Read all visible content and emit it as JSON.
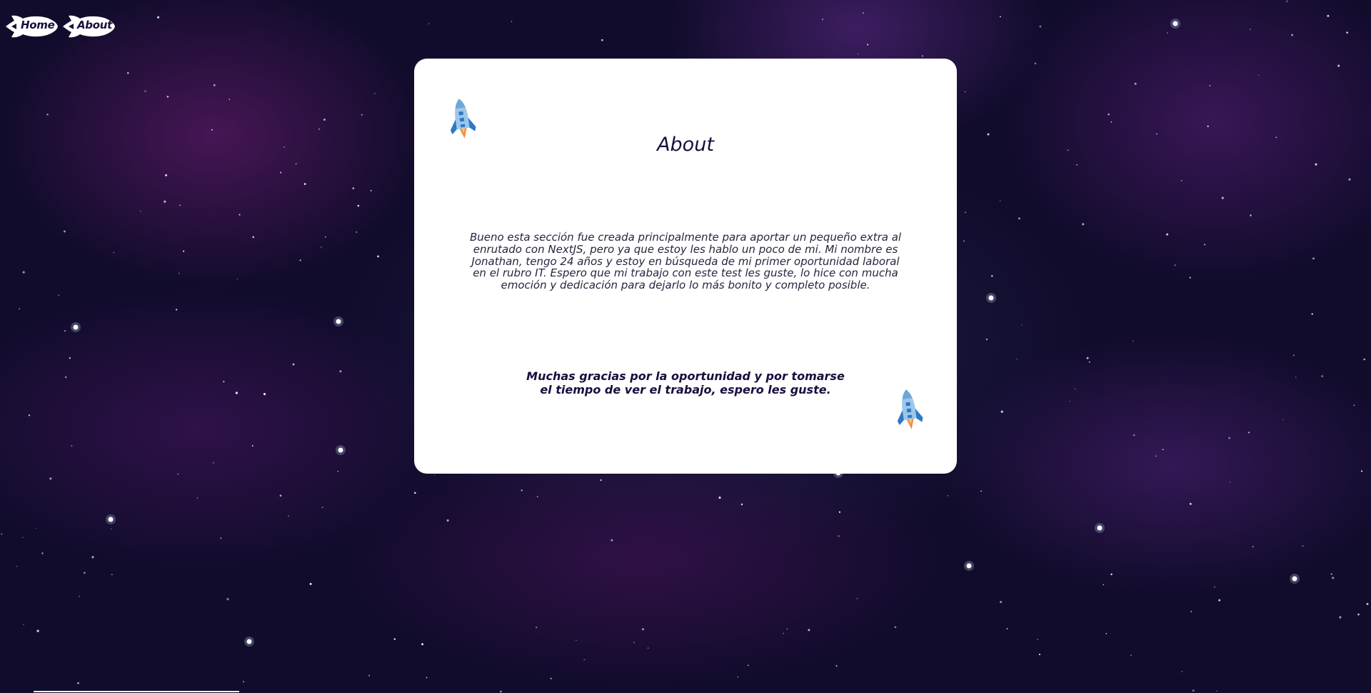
{
  "nav": {
    "home_label": "Home",
    "about_label": "About"
  },
  "card": {
    "title": "About",
    "text": "Bueno esta sección fue creada principalmente para aportar un pequeño extra al enrutado con NextJS, pero ya que estoy les hablo un poco de mi. Mi nombre es Jonathan, tengo 24 años y estoy en búsqueda de mi primer oportunidad laboral en el rubro IT. Espero que mi trabajo con este test les guste, lo hice con mucha emoción y dedicación para dejarlo lo más bonito y completo posible.",
    "thanks": "Muchas gracias por la oportunidad y por tomarse el tiempo de ver el trabajo, espero les guste."
  },
  "icons": {
    "nav_button_shape": "rocket-shape-icon",
    "card_decoration": "rocket-icon"
  },
  "colors": {
    "background": "#120c2c",
    "card": "#ffffff",
    "text_dark": "#1b0d3d",
    "rocket_body": "#9cc7ea",
    "rocket_fins": "#2f78c4",
    "rocket_flame": "#f08a4b"
  }
}
